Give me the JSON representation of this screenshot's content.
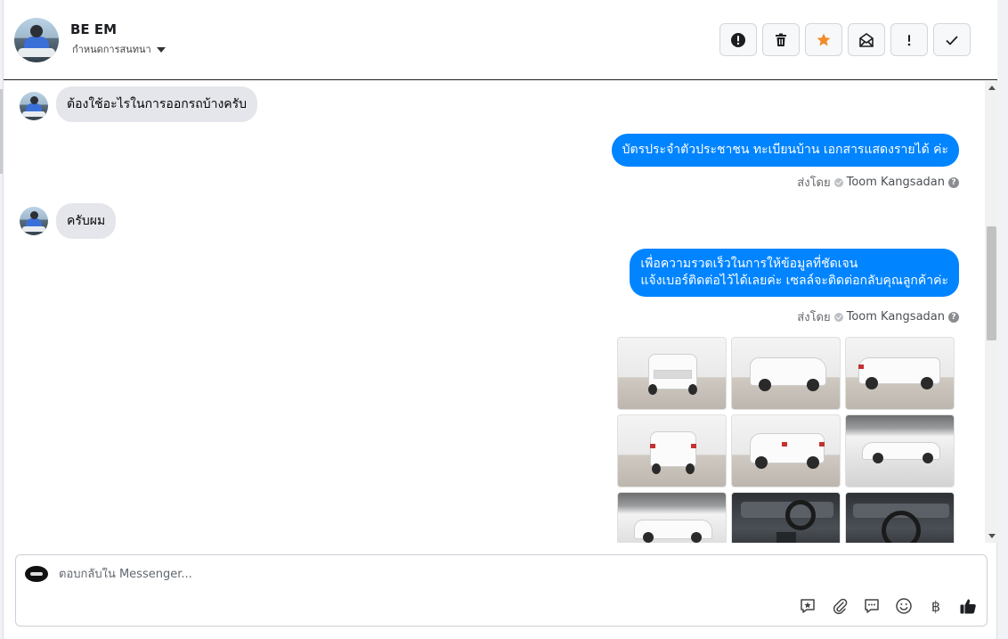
{
  "header": {
    "contact_name": "BE EM",
    "assign_label": "กำหนดการสนทนา"
  },
  "toolbar": {
    "buttons": [
      {
        "name": "mark-spam",
        "icon": "exclamation-circle-icon"
      },
      {
        "name": "delete",
        "icon": "trash-icon"
      },
      {
        "name": "star",
        "icon": "star-icon",
        "color": "#f28c28"
      },
      {
        "name": "mark-unread",
        "icon": "open-envelope-icon"
      },
      {
        "name": "flag",
        "icon": "exclamation-icon",
        "label": "!"
      },
      {
        "name": "mark-done",
        "icon": "checkmark-icon"
      }
    ]
  },
  "messages": [
    {
      "direction": "in",
      "text": "ต้องใช้อะไรในการออกรถบ้างครับ"
    },
    {
      "direction": "out",
      "text": "บัตรประจำตัวประชาชน ทะเบียนบ้าน เอกสารแสดงรายได้ ค่ะ",
      "sent_by_label": "ส่งโดย",
      "agent": "Toom Kangsadan"
    },
    {
      "direction": "in",
      "text": "ครับผม"
    },
    {
      "direction": "out",
      "lines": [
        "เพื่อความรวดเร็วในการให้ข้อมูลที่ชัดเจน",
        "แจ้งเบอร์ติดต่อไว้ได้เลยค่ะ เซลล์จะติดต่อกลับคุณลูกค้าค่ะ"
      ],
      "sent_by_label": "ส่งโดย",
      "agent": "Toom Kangsadan"
    }
  ],
  "composer": {
    "placeholder": "ตอบกลับใน Messenger...",
    "currency_symbol": "฿"
  },
  "colors": {
    "outgoing_bubble": "#0084ff",
    "incoming_bubble": "#e4e6eb",
    "like_icon": "#1c1e21"
  }
}
